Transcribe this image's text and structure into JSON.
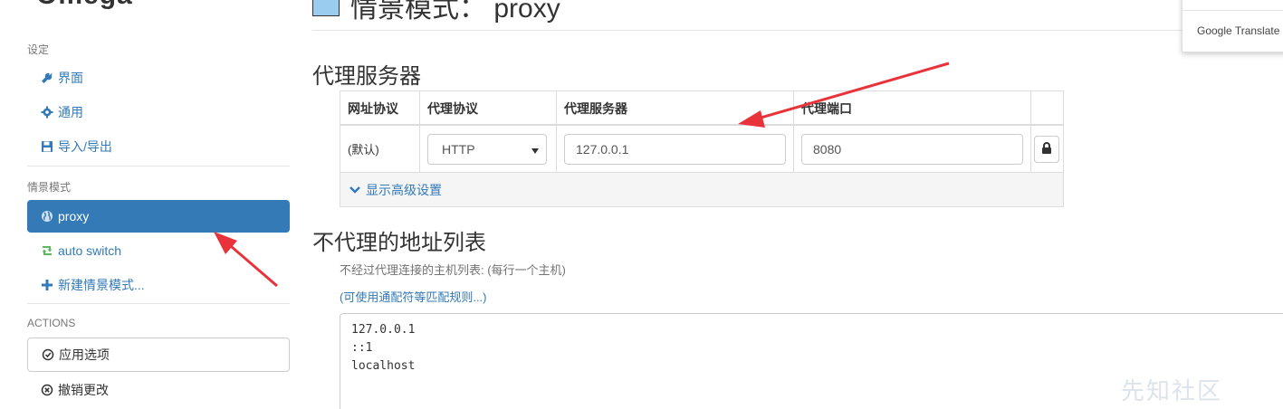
{
  "sidebar": {
    "brand_partial": "Omega",
    "settings_label": "设定",
    "settings_items": [
      {
        "label": "界面",
        "icon": "wrench-icon"
      },
      {
        "label": "通用",
        "icon": "gear-icon"
      },
      {
        "label": "导入/导出",
        "icon": "floppy-icon"
      }
    ],
    "profiles_label": "情景模式",
    "profile_items": [
      {
        "label": "proxy",
        "icon": "globe-icon"
      },
      {
        "label": "auto switch",
        "icon": "retweet-icon"
      },
      {
        "label": "新建情景模式...",
        "icon": "plus-icon"
      }
    ],
    "actions_label": "ACTIONS",
    "apply_label": "应用选项",
    "undo_label": "撤销更改"
  },
  "header": {
    "title": "情景模式： proxy",
    "profile_color": "#99ccee"
  },
  "proxy_section": {
    "heading": "代理服务器",
    "columns": [
      "网址协议",
      "代理协议",
      "代理服务器",
      "代理端口"
    ],
    "row": {
      "scheme": "(默认)",
      "protocol": "HTTP",
      "server": "127.0.0.1",
      "port": "8080"
    },
    "advanced_label": "显示高级设置"
  },
  "bypass_section": {
    "heading": "不代理的地址列表",
    "help": "不经过代理连接的主机列表: (每行一个主机)",
    "wildcard_link": "(可使用通配符等匹配规则...)",
    "list": "127.0.0.1\n::1\nlocalhost"
  },
  "translate_popup": {
    "label": "Google Translate"
  },
  "watermark": "先知社区",
  "colors": {
    "accent": "#337ab7",
    "annotation_arrow": "#e8333a"
  }
}
